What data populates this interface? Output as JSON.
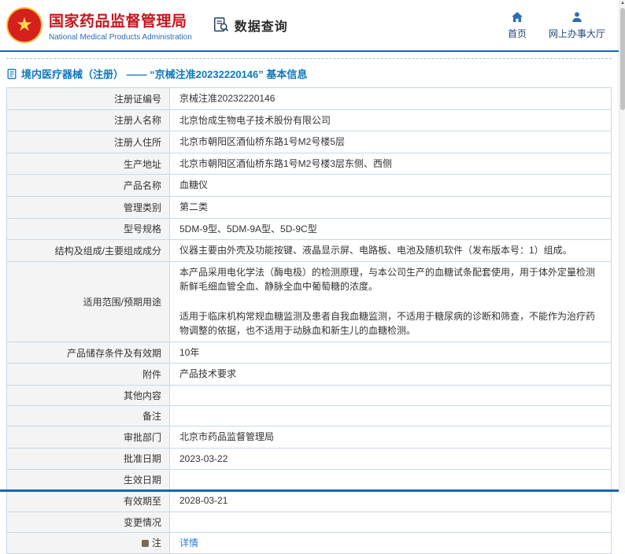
{
  "header": {
    "agency_name_cn": "国家药品监督管理局",
    "agency_name_en": "National Medical Products Administration",
    "section_title": "数据查询",
    "nav": [
      {
        "label": "首页",
        "icon": "home-icon"
      },
      {
        "label": "网上办事大厅",
        "icon": "person-icon"
      }
    ]
  },
  "page": {
    "title": "境内医疗器械（注册） —— “京械注准20232220146” 基本信息"
  },
  "table": {
    "rows": [
      {
        "label": "注册证编号",
        "value": "京械注准20232220146"
      },
      {
        "label": "注册人名称",
        "value": "北京怡成生物电子技术股份有限公司"
      },
      {
        "label": "注册人住所",
        "value": "北京市朝阳区酒仙桥东路1号M2号楼5层"
      },
      {
        "label": "生产地址",
        "value": "北京市朝阳区酒仙桥东路1号M2号楼3层东侧、西侧"
      },
      {
        "label": "产品名称",
        "value": "血糖仪"
      },
      {
        "label": "管理类别",
        "value": "第二类"
      },
      {
        "label": "型号规格",
        "value": "5DM-9型、5DM-9A型、5D-9C型"
      },
      {
        "label": "结构及组成/主要组成成分",
        "value": "仪器主要由外壳及功能按键、液晶显示屏、电路板、电池及随机软件（发布版本号：1）组成。"
      },
      {
        "label": "适用范围/预期用途",
        "value": "本产品采用电化学法（酶电极）的检测原理，与本公司生产的血糖试条配套使用，用于体外定量检测新鲜毛细血管全血、静脉全血中葡萄糖的浓度。\n\n适用于临床机构常规血糖监测及患者自我血糖监测，不适用于糖尿病的诊断和筛查，不能作为治疗药物调整的依据，也不适用于动脉血和新生儿的血糖检测。"
      },
      {
        "label": "产品储存条件及有效期",
        "value": "10年"
      },
      {
        "label": "附件",
        "value": "产品技术要求"
      },
      {
        "label": "其他内容",
        "value": ""
      },
      {
        "label": "备注",
        "value": ""
      },
      {
        "label": "审批部门",
        "value": "北京市药品监督管理局"
      },
      {
        "label": "批准日期",
        "value": "2023-03-22"
      },
      {
        "label": "生效日期",
        "value": ""
      },
      {
        "label": "有效期至",
        "value": "2028-03-21"
      },
      {
        "label": "变更情况",
        "value": ""
      },
      {
        "label": "注",
        "value": "详情",
        "link": true,
        "label_icon": "note-icon"
      }
    ]
  }
}
